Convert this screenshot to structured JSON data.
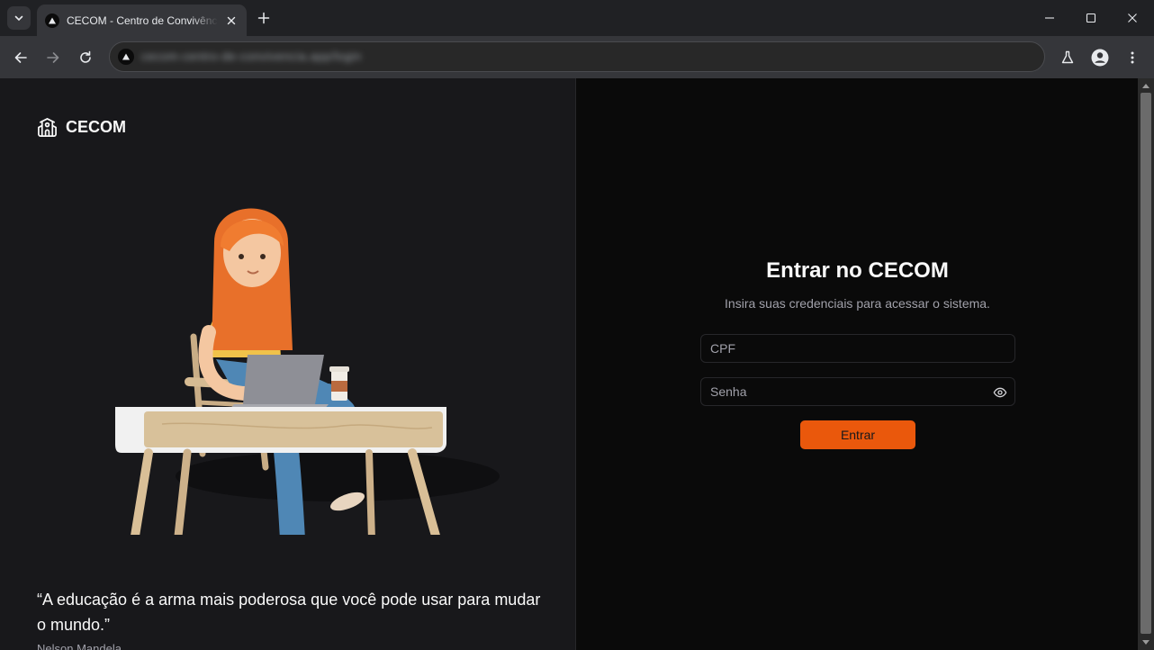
{
  "browser": {
    "tab_title": "CECOM - Centro de Convivência",
    "address_url": "cecom-centro-de-convivencia.app/login"
  },
  "brand": {
    "name": "CECOM",
    "icon": "school-building-icon"
  },
  "hero": {
    "illustration": "woman-at-desk-with-laptop-illustration",
    "quote": "“A educação é a arma mais poderosa que você pode usar para mudar o mundo.”",
    "quote_author": "Nelson Mandela"
  },
  "login": {
    "title": "Entrar no CECOM",
    "subtitle": "Insira suas credenciais para acessar o sistema.",
    "cpf_placeholder": "CPF",
    "cpf_value": "",
    "password_placeholder": "Senha",
    "password_value": "",
    "submit_label": "Entrar"
  },
  "colors": {
    "accent": "#ea580c",
    "left_panel_bg": "#18181b",
    "right_panel_bg": "#0a0a0a",
    "border": "#27272a"
  }
}
